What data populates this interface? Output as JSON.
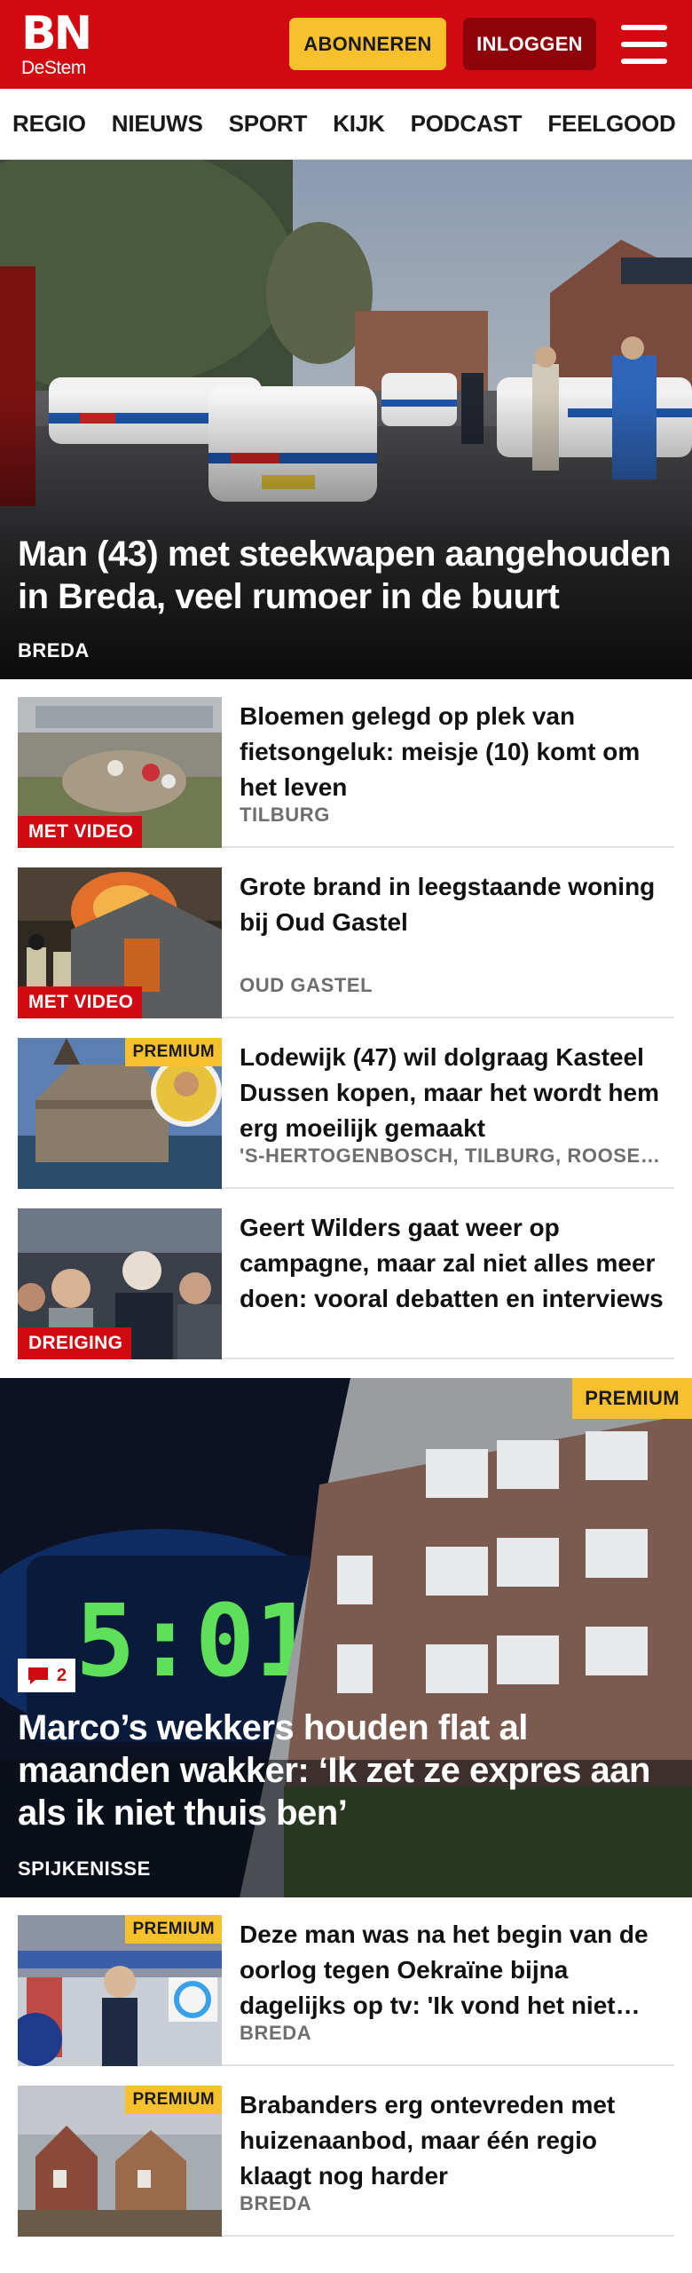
{
  "header": {
    "logo_main": "BN",
    "logo_sub": "DeStem",
    "subscribe_label": "ABONNEREN",
    "login_label": "INLOGGEN"
  },
  "nav": {
    "items": [
      "REGIO",
      "NIEUWS",
      "SPORT",
      "KIJK",
      "PODCAST",
      "FEELGOOD"
    ]
  },
  "hero": {
    "title": "Man (43) met steekwapen aangehouden in Breda, veel rumoer in de buurt",
    "location": "BREDA"
  },
  "articles": [
    {
      "title": "Bloemen gelegd op plek van fietsongeluk: meisje (10) komt om het leven",
      "location": "TILBURG",
      "label": "MET VIDEO",
      "premium": ""
    },
    {
      "title": "Grote brand in leegstaande woning bij Oud Gastel",
      "location": "OUD GASTEL",
      "label": "MET VIDEO",
      "premium": ""
    },
    {
      "title": "Lodewijk (47) wil dolgraag Kasteel Dussen kopen, maar het wordt hem erg moeilijk gemaakt",
      "location": "'S-HERTOGENBOSCH, TILBURG, ROOSENDAAL",
      "label": "",
      "premium": "PREMIUM"
    },
    {
      "title": "Geert Wilders gaat weer op campagne, maar zal niet alles meer doen: vooral debatten en interviews",
      "location": "",
      "label": "DREIGING",
      "premium": ""
    }
  ],
  "feature": {
    "premium": "PREMIUM",
    "comment_count": "2",
    "clock_text": "5:01",
    "title": "Marco’s wekkers houden flat al maanden wakker: ‘Ik zet ze expres aan als ik niet thuis ben’",
    "location": "SPIJKENISSE"
  },
  "articles2": [
    {
      "title": "Deze man was na het begin van de oorlog tegen Oekraïne bijna dagelijks op tv: 'Ik vond het niet altijd leuk'",
      "location": "BREDA",
      "premium": "PREMIUM"
    },
    {
      "title": "Brabanders erg ontevreden met huizenaanbod, maar één regio klaagt nog harder",
      "location": "BREDA",
      "premium": "PREMIUM"
    }
  ],
  "colors": {
    "brand_red": "#d10a11",
    "dark_red": "#8e0309",
    "premium_yellow": "#f7c12e"
  },
  "icons": [
    "menu-icon",
    "comment-icon"
  ]
}
